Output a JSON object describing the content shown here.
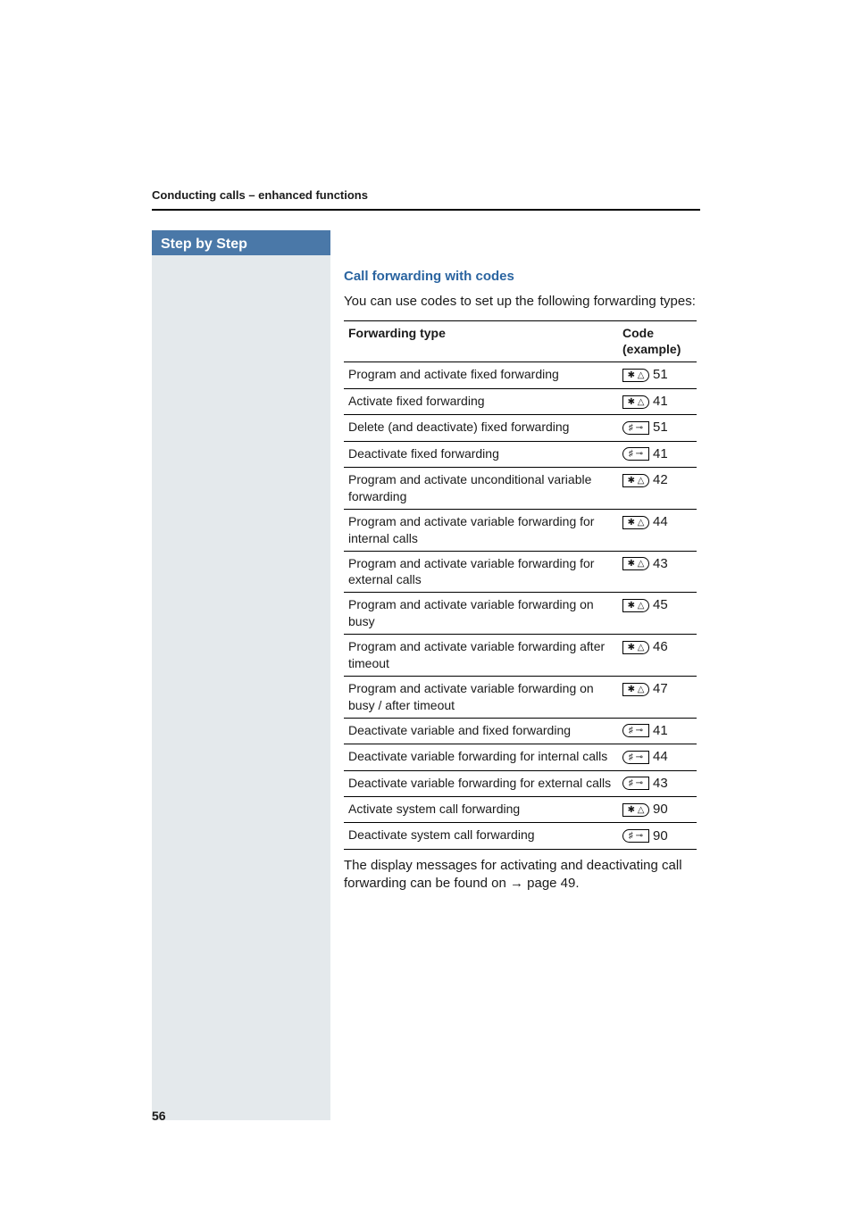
{
  "running_head": "Conducting calls – enhanced functions",
  "sidebar_title": "Step by Step",
  "sub_heading": "Call forwarding with codes",
  "intro": "You can use codes to set up the following forwarding types:",
  "table": {
    "head_type": "Forwarding type",
    "head_code": "Code (example)",
    "rows": [
      {
        "type": "Program and activate fixed forwarding",
        "key": "star",
        "num": "51"
      },
      {
        "type": "Activate fixed forwarding",
        "key": "star",
        "num": "41"
      },
      {
        "type": "Delete (and deactivate) fixed forwarding",
        "key": "hash",
        "num": "51"
      },
      {
        "type": "Deactivate fixed forwarding",
        "key": "hash",
        "num": "41"
      },
      {
        "type": "Program and activate unconditional variable forwarding",
        "key": "star",
        "num": "42"
      },
      {
        "type": "Program and activate variable forwarding for internal calls",
        "key": "star",
        "num": "44"
      },
      {
        "type": "Program and activate variable forwarding for external calls",
        "key": "star",
        "num": "43"
      },
      {
        "type": "Program and activate variable forwarding on busy",
        "key": "star",
        "num": "45"
      },
      {
        "type": "Program and activate variable forwarding after timeout",
        "key": "star",
        "num": "46"
      },
      {
        "type": "Program and activate variable forwarding on busy / after timeout",
        "key": "star",
        "num": "47"
      },
      {
        "type": "Deactivate variable and fixed forwarding",
        "key": "hash",
        "num": "41"
      },
      {
        "type": "Deactivate variable forwarding for internal calls",
        "key": "hash",
        "num": "44"
      },
      {
        "type": "Deactivate variable forwarding for external calls",
        "key": "hash",
        "num": "43"
      },
      {
        "type": "Activate system call forwarding",
        "key": "star",
        "num": "90"
      },
      {
        "type": "Deactivate system call forwarding",
        "key": "hash",
        "num": "90"
      }
    ]
  },
  "key_glyph": {
    "star": "✱ △",
    "hash": "♯ ⊸"
  },
  "outro_a": "The display messages for activating and deactivating call forwarding can be found on ",
  "outro_arrow": "→",
  "outro_b": " page 49.",
  "page_number": "56"
}
